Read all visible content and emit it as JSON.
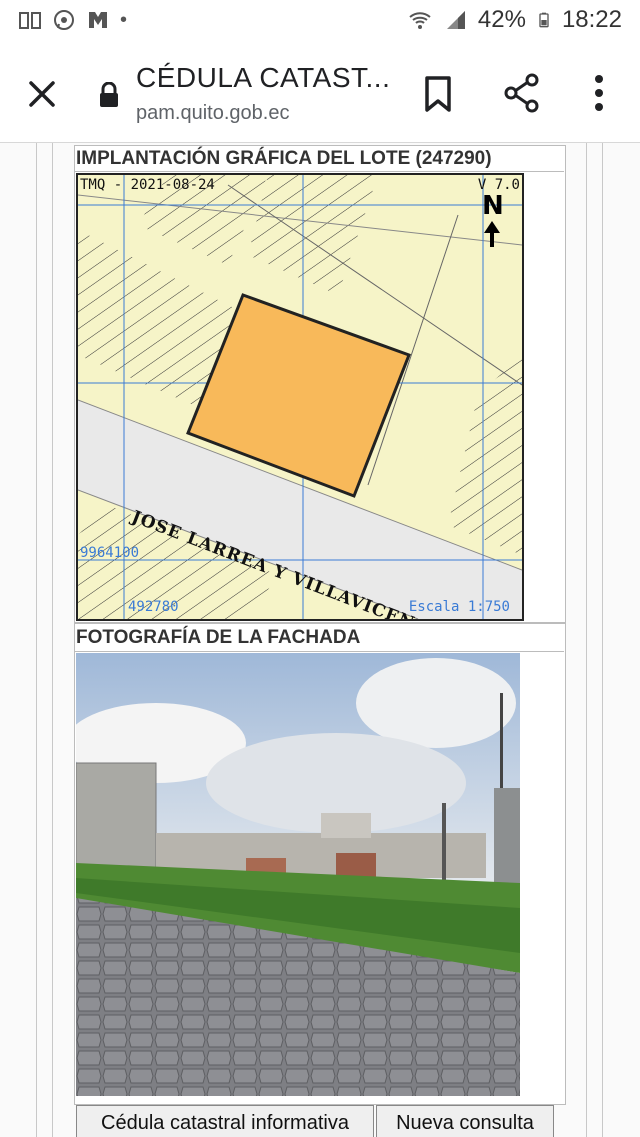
{
  "status_bar": {
    "battery_percent": "42%",
    "time": "18:22",
    "left_icons": [
      "book-icon",
      "whatsapp-icon",
      "brand-icon",
      "dot-icon"
    ],
    "right_icons": [
      "wifi-icon",
      "signal-icon",
      "battery-icon"
    ]
  },
  "browser": {
    "title": "CÉDULA CATAST...",
    "url": "pam.quito.gob.ec"
  },
  "sections": {
    "map_title": "IMPLANTACIÓN GRÁFICA DEL LOTE (247290)",
    "photo_title": "FOTOGRAFÍA DE LA FACHADA"
  },
  "map": {
    "header_left": "TMQ - 2021-08-24",
    "version": "V 7.0",
    "north": "N",
    "street_name": "JOSE LARREA Y VILLAVICENCIO",
    "coord_y": "9964100",
    "coord_x": "492780",
    "scale": "Escala 1:750"
  },
  "buttons": {
    "info_label": "Cédula catastral informativa",
    "new_query_label": "Nueva consulta"
  }
}
